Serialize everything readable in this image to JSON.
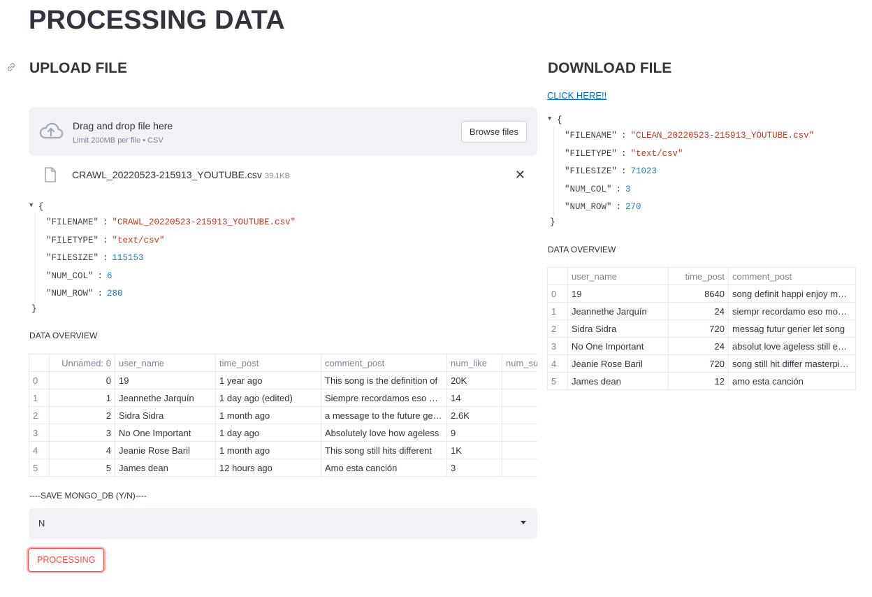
{
  "page": {
    "title": "PROCESSING DATA"
  },
  "upload": {
    "heading": "UPLOAD FILE",
    "dropzone": {
      "main": "Drag and drop file here",
      "sub": "Limit 200MB per file • CSV",
      "browse_label": "Browse files"
    },
    "file": {
      "name": "CRAWL_20220523-215913_YOUTUBE.csv",
      "size": "39.1KB",
      "close_glyph": "✕"
    },
    "json": [
      {
        "key": "\"FILENAME\"",
        "value": "\"CRAWL_20220523-215913_YOUTUBE.csv\"",
        "kind": "str"
      },
      {
        "key": "\"FILETYPE\"",
        "value": "\"text/csv\"",
        "kind": "str"
      },
      {
        "key": "\"FILESIZE\"",
        "value": "115153",
        "kind": "num"
      },
      {
        "key": "\"NUM_COL\"",
        "value": "6",
        "kind": "num"
      },
      {
        "key": "\"NUM_ROW\"",
        "value": "280",
        "kind": "num"
      }
    ],
    "overview_label": "DATA OVERVIEW",
    "table": {
      "columns": [
        "",
        "Unnamed: 0",
        "user_name",
        "time_post",
        "comment_post",
        "num_like",
        "num_su"
      ],
      "rows": [
        [
          "0",
          "0",
          "19",
          "1 year ago",
          "This song is the definition of",
          "20K",
          ""
        ],
        [
          "1",
          "1",
          "Jeannethe Jarquín",
          "1 day ago (edited)",
          "Siempre recordamos eso momentos",
          "14",
          ""
        ],
        [
          "2",
          "2",
          "Sidra Sidra",
          "1 month ago",
          "a message to the future generation",
          "2.6K",
          ""
        ],
        [
          "3",
          "3",
          "No One Important",
          "1 day ago",
          "Absolutely love how ageless",
          "9",
          ""
        ],
        [
          "4",
          "4",
          "Jeanie Rose Baril",
          "1 month ago",
          "This song still hits different",
          "1K",
          ""
        ],
        [
          "5",
          "5",
          "James dean",
          "12 hours ago",
          "Amo esta canción",
          "3",
          ""
        ]
      ]
    },
    "save_label": "----SAVE MONGO_DB (Y/N)----",
    "save_value": "N",
    "process_label": "PROCESSING"
  },
  "download": {
    "heading": "DOWNLOAD FILE",
    "link_label": "CLICK HERE!!",
    "json": [
      {
        "key": "\"FILENAME\"",
        "value": "\"CLEAN_20220523-215913_YOUTUBE.csv\"",
        "kind": "str"
      },
      {
        "key": "\"FILETYPE\"",
        "value": "\"text/csv\"",
        "kind": "str"
      },
      {
        "key": "\"FILESIZE\"",
        "value": "71023",
        "kind": "num"
      },
      {
        "key": "\"NUM_COL\"",
        "value": "3",
        "kind": "num"
      },
      {
        "key": "\"NUM_ROW\"",
        "value": "270",
        "kind": "num"
      }
    ],
    "overview_label": "DATA OVERVIEW",
    "table": {
      "columns": [
        "",
        "user_name",
        "time_post",
        "comment_post"
      ],
      "rows": [
        [
          "0",
          "19",
          "8640",
          "song definit happi enjoy moment"
        ],
        [
          "1",
          "Jeannethe Jarquín",
          "24",
          "siempr recordamo eso momento"
        ],
        [
          "2",
          "Sidra Sidra",
          "720",
          "messag futur gener let song"
        ],
        [
          "3",
          "No One Important",
          "24",
          "absolut love ageless still enjoy"
        ],
        [
          "4",
          "Jeanie Rose Baril",
          "720",
          "song still hit differ masterpiece"
        ],
        [
          "5",
          "James dean",
          "12",
          "amo esta canción"
        ]
      ]
    }
  },
  "json_braces": {
    "open": "{",
    "close": "}"
  },
  "colors": {
    "accent": "#ff4b4b",
    "string": "#c0391f",
    "number": "#1c7dc4",
    "panel": "#f0f2f6"
  }
}
